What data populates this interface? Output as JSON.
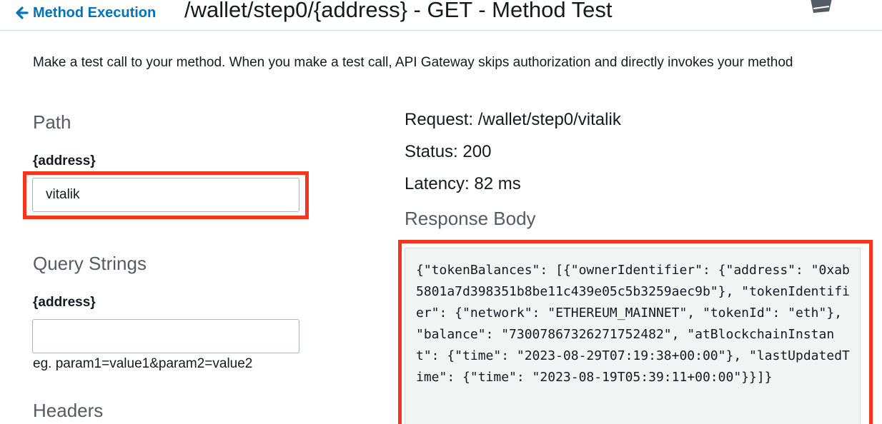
{
  "header": {
    "back_label": "Method Execution",
    "title": "/wallet/step0/{address} - GET - Method Test"
  },
  "intro": "Make a test call to your method. When you make a test call, API Gateway skips authorization and directly invokes your method",
  "path_section": {
    "heading": "Path",
    "field_label": "{address}",
    "value": "vitalik"
  },
  "query_section": {
    "heading": "Query Strings",
    "field_label": "{address}",
    "value": "",
    "hint": "eg. param1=value1&param2=value2"
  },
  "headers_section": {
    "heading": "Headers"
  },
  "response": {
    "request": "Request: /wallet/step0/vitalik",
    "status": "Status: 200",
    "latency": "Latency: 82 ms",
    "body_heading": "Response Body",
    "body": "{\"tokenBalances\": [{\"ownerIdentifier\": {\"address\": \"0xab5801a7d398351b8be11c439e05c5b3259aec9b\"}, \"tokenIdentifier\": {\"network\": \"ETHEREUM_MAINNET\", \"tokenId\": \"eth\"}, \"balance\": \"73007867326271752482\", \"atBlockchainInstant\": {\"time\": \"2023-08-29T07:19:38+00:00\"}, \"lastUpdatedTime\": {\"time\": \"2023-08-19T05:39:11+00:00\"}}]}"
  },
  "colors": {
    "link": "#0073bb",
    "highlight": "#f4361c",
    "code_bg": "#f2f3f3"
  }
}
